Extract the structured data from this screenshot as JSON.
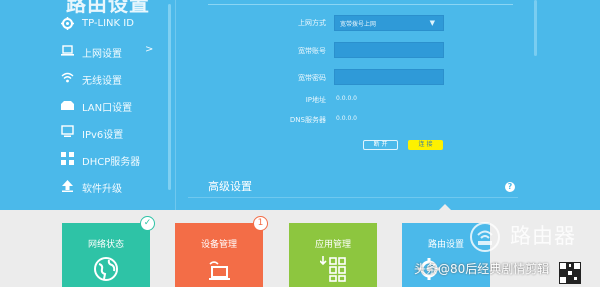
{
  "sidebar": {
    "title": "路由设置",
    "items": [
      {
        "label": "TP-LINK ID",
        "icon": "gear-icon"
      },
      {
        "label": "上网设置",
        "icon": "laptop-icon",
        "arrow": ">"
      },
      {
        "label": "无线设置",
        "icon": "wifi-icon"
      },
      {
        "label": "LAN口设置",
        "icon": "lan-icon"
      },
      {
        "label": "IPv6设置",
        "icon": "monitor-icon"
      },
      {
        "label": "DHCP服务器",
        "icon": "dhcp-icon"
      },
      {
        "label": "软件升级",
        "icon": "upload-icon"
      }
    ]
  },
  "form": {
    "connection_type_label": "上网方式",
    "connection_type_value": "宽带拨号上网",
    "account_label": "宽带账号",
    "account_value": "",
    "password_label": "宽带密码",
    "password_value": "",
    "ip_label": "IP地址",
    "ip_value": "0.0.0.0",
    "dns_label": "DNS服务器",
    "dns_value": "0.0.0.0",
    "disconnect_label": "断 开",
    "connect_label": "连 接"
  },
  "advanced": {
    "title": "高级设置",
    "help": "?"
  },
  "tiles": [
    {
      "label": "网络状态",
      "color": "#2ec3a6",
      "badge": "✓",
      "badge_color": "#2ec3a6"
    },
    {
      "label": "设备管理",
      "color": "#f36d47",
      "badge": "1",
      "badge_color": "#f36d47"
    },
    {
      "label": "应用管理",
      "color": "#8dc63f"
    },
    {
      "label": "路由设置",
      "color": "#4bb9ea"
    }
  ],
  "watermark": {
    "site": "路由器",
    "text": "头条@80后经典剧情剪辑"
  }
}
